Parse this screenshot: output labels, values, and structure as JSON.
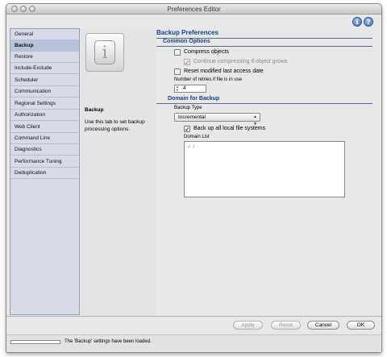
{
  "window": {
    "title": "Preferences Editor"
  },
  "toolbar": {
    "info_icon": "info-icon",
    "help_icon": "help-icon"
  },
  "sidebar": {
    "items": [
      {
        "label": "General"
      },
      {
        "label": "Backup",
        "selected": true
      },
      {
        "label": "Restore"
      },
      {
        "label": "Include-Exclude"
      },
      {
        "label": "Scheduler"
      },
      {
        "label": "Communication"
      },
      {
        "label": "Regional Settings"
      },
      {
        "label": "Authorization"
      },
      {
        "label": "Web Client"
      },
      {
        "label": "Command Line"
      },
      {
        "label": "Diagnostics"
      },
      {
        "label": "Performance Tuning"
      },
      {
        "label": "Deduplication"
      }
    ]
  },
  "description": {
    "title": "Backup",
    "text": "Use this tab to set backup processing options."
  },
  "main": {
    "heading": "Backup Preferences",
    "common": {
      "heading": "Common Options",
      "compress_objects": {
        "label": "Compress objects",
        "checked": false
      },
      "continue_compressing": {
        "label": "Continue compressing if object grows",
        "checked": true,
        "disabled": true
      },
      "reset_access_date": {
        "label": "Reset modified last access date",
        "checked": false
      },
      "retries_label": "Number of retries if file is in use",
      "retries_value": "4"
    },
    "domain": {
      "heading": "Domain for Backup",
      "backup_type_label": "Backup Type",
      "backup_type_value": "Incremental",
      "backup_all_local": {
        "label": "Back up all local file systems",
        "checked": true
      },
      "domain_list_label": "Domain List",
      "domain_list_items": [
        "/"
      ]
    }
  },
  "buttons": {
    "apply": "Apply",
    "reset": "Reset",
    "cancel": "Cancel",
    "ok": "OK"
  },
  "status": {
    "text": "The 'Backup' settings have been loaded."
  }
}
